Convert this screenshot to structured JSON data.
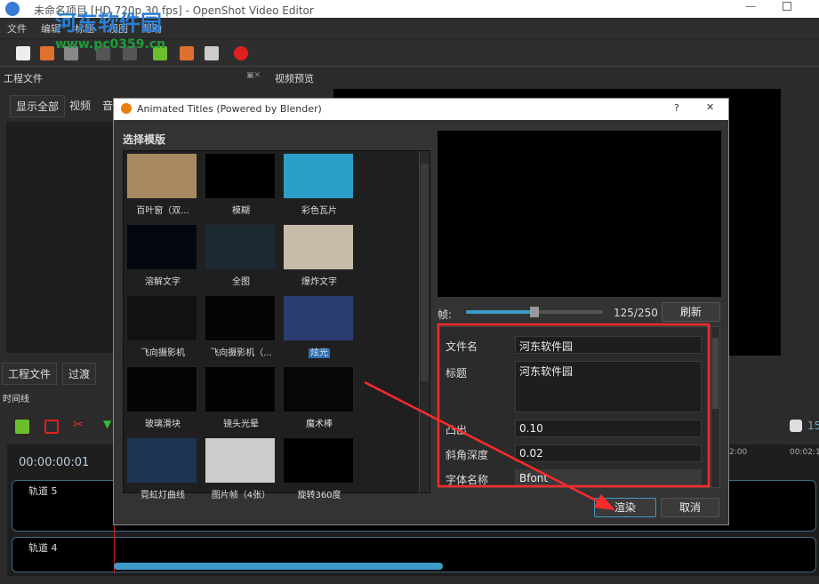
{
  "window": {
    "title": "未命名项目 [HD 720p 30 fps] - OpenShot Video Editor"
  },
  "watermark": {
    "name": "河东软件园",
    "url": "www.pc0359.cn"
  },
  "menu": [
    "文件",
    "编辑",
    "标题",
    "视图",
    "帮助"
  ],
  "left_panel": {
    "title": "工程文件",
    "filters": [
      "显示全部",
      "视频",
      "音"
    ]
  },
  "preview_panel": {
    "title": "视频预览"
  },
  "bottom_tabs": [
    "工程文件",
    "过渡"
  ],
  "timeline": {
    "title": "时间线",
    "timecode": "00:00:00:01",
    "zoom_value": "15",
    "ruler": [
      "2:00",
      "00:02:1"
    ],
    "tracks": [
      "轨道 5",
      "轨道 4"
    ]
  },
  "dialog": {
    "title": "Animated Titles (Powered by Blender)",
    "help": "?",
    "close": "✕",
    "section": "选择模版",
    "templates": [
      "百叶窗（双...",
      "模糊",
      "彩色瓦片",
      "溶解文字",
      "全图",
      "爆炸文字",
      "飞向摄影机",
      "飞向摄影机（...",
      "炫光",
      "玻璃滑块",
      "镜头光晕",
      "魔术棒",
      "霓虹灯曲线",
      "图片帧（4张）",
      "旋转360度"
    ],
    "selected_template": "炫光",
    "frame_label": "帧:",
    "frame_value": "125/250",
    "frame_fraction": 0.5,
    "refresh": "刷新",
    "props": [
      {
        "label": "文件名",
        "value": "河东软件园"
      },
      {
        "label": "标题",
        "value": "河东软件园"
      },
      {
        "label": "凸出",
        "value": "0.10"
      },
      {
        "label": "斜角深度",
        "value": "0.02"
      },
      {
        "label": "字体名称",
        "value": "Bfont"
      }
    ],
    "render": "渲染",
    "cancel": "取消"
  },
  "colors": {
    "annotation": "#ff2a2a",
    "accent": "#2d6fb3"
  }
}
